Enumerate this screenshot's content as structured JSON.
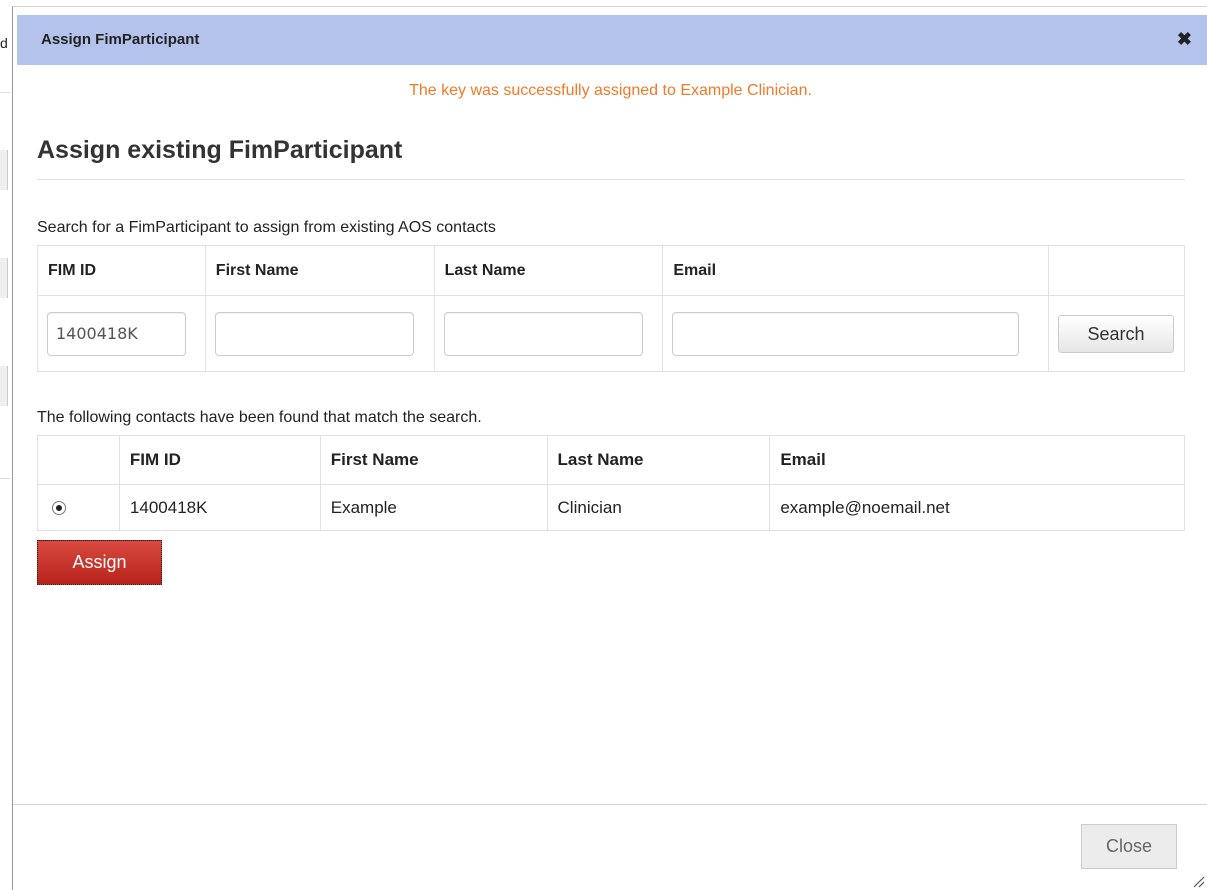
{
  "background": {
    "partial_text": "d"
  },
  "dialog": {
    "title": "Assign FimParticipant",
    "close_glyph": "✖",
    "success_message": "The key was successfully assigned to Example Clinician.",
    "section_title": "Assign existing FimParticipant",
    "search": {
      "caption": "Search for a FimParticipant to assign from existing AOS contacts",
      "headers": {
        "fim_id": "FIM ID",
        "first_name": "First Name",
        "last_name": "Last Name",
        "email": "Email"
      },
      "values": {
        "fim_id": "1400418K",
        "first_name": "",
        "last_name": "",
        "email": ""
      },
      "search_label": "Search"
    },
    "results": {
      "caption": "The following contacts have been found that match the search.",
      "headers": {
        "fim_id": "FIM ID",
        "first_name": "First Name",
        "last_name": "Last Name",
        "email": "Email"
      },
      "rows": [
        {
          "selected": true,
          "fim_id": "1400418K",
          "first_name": "Example",
          "last_name": "Clinician",
          "email": "example@noemail.net"
        }
      ]
    },
    "assign_label": "Assign",
    "close_label": "Close"
  },
  "colors": {
    "titlebar": "#b4c3ec",
    "success": "#f07a28",
    "assign_button": "#c7352c"
  }
}
